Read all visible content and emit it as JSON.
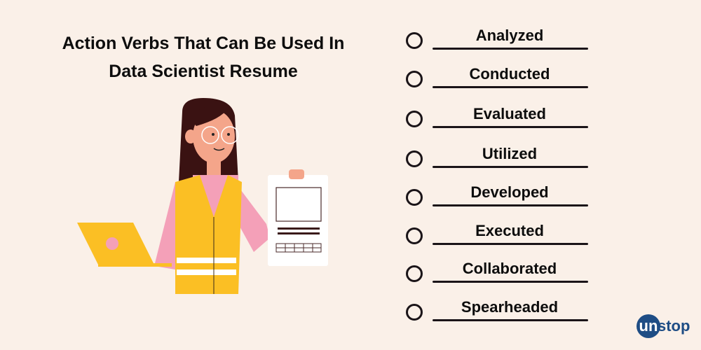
{
  "title": "Action Verbs That  Can Be Used In Data Scientist Resume",
  "title_lines": [
    "Action Verbs That  Can Be Used In",
    "Data Scientist Resume"
  ],
  "verbs": [
    "Analyzed",
    "Conducted",
    "Evaluated",
    "Utilized",
    "Developed",
    "Executed",
    "Collaborated",
    "Spearheaded"
  ],
  "logo": {
    "badge": "un",
    "rest": "stop"
  },
  "colors": {
    "background": "#faf0e8",
    "brand": "#1e4d85",
    "vest": "#fbbf24",
    "shirt": "#f4a0b8"
  }
}
